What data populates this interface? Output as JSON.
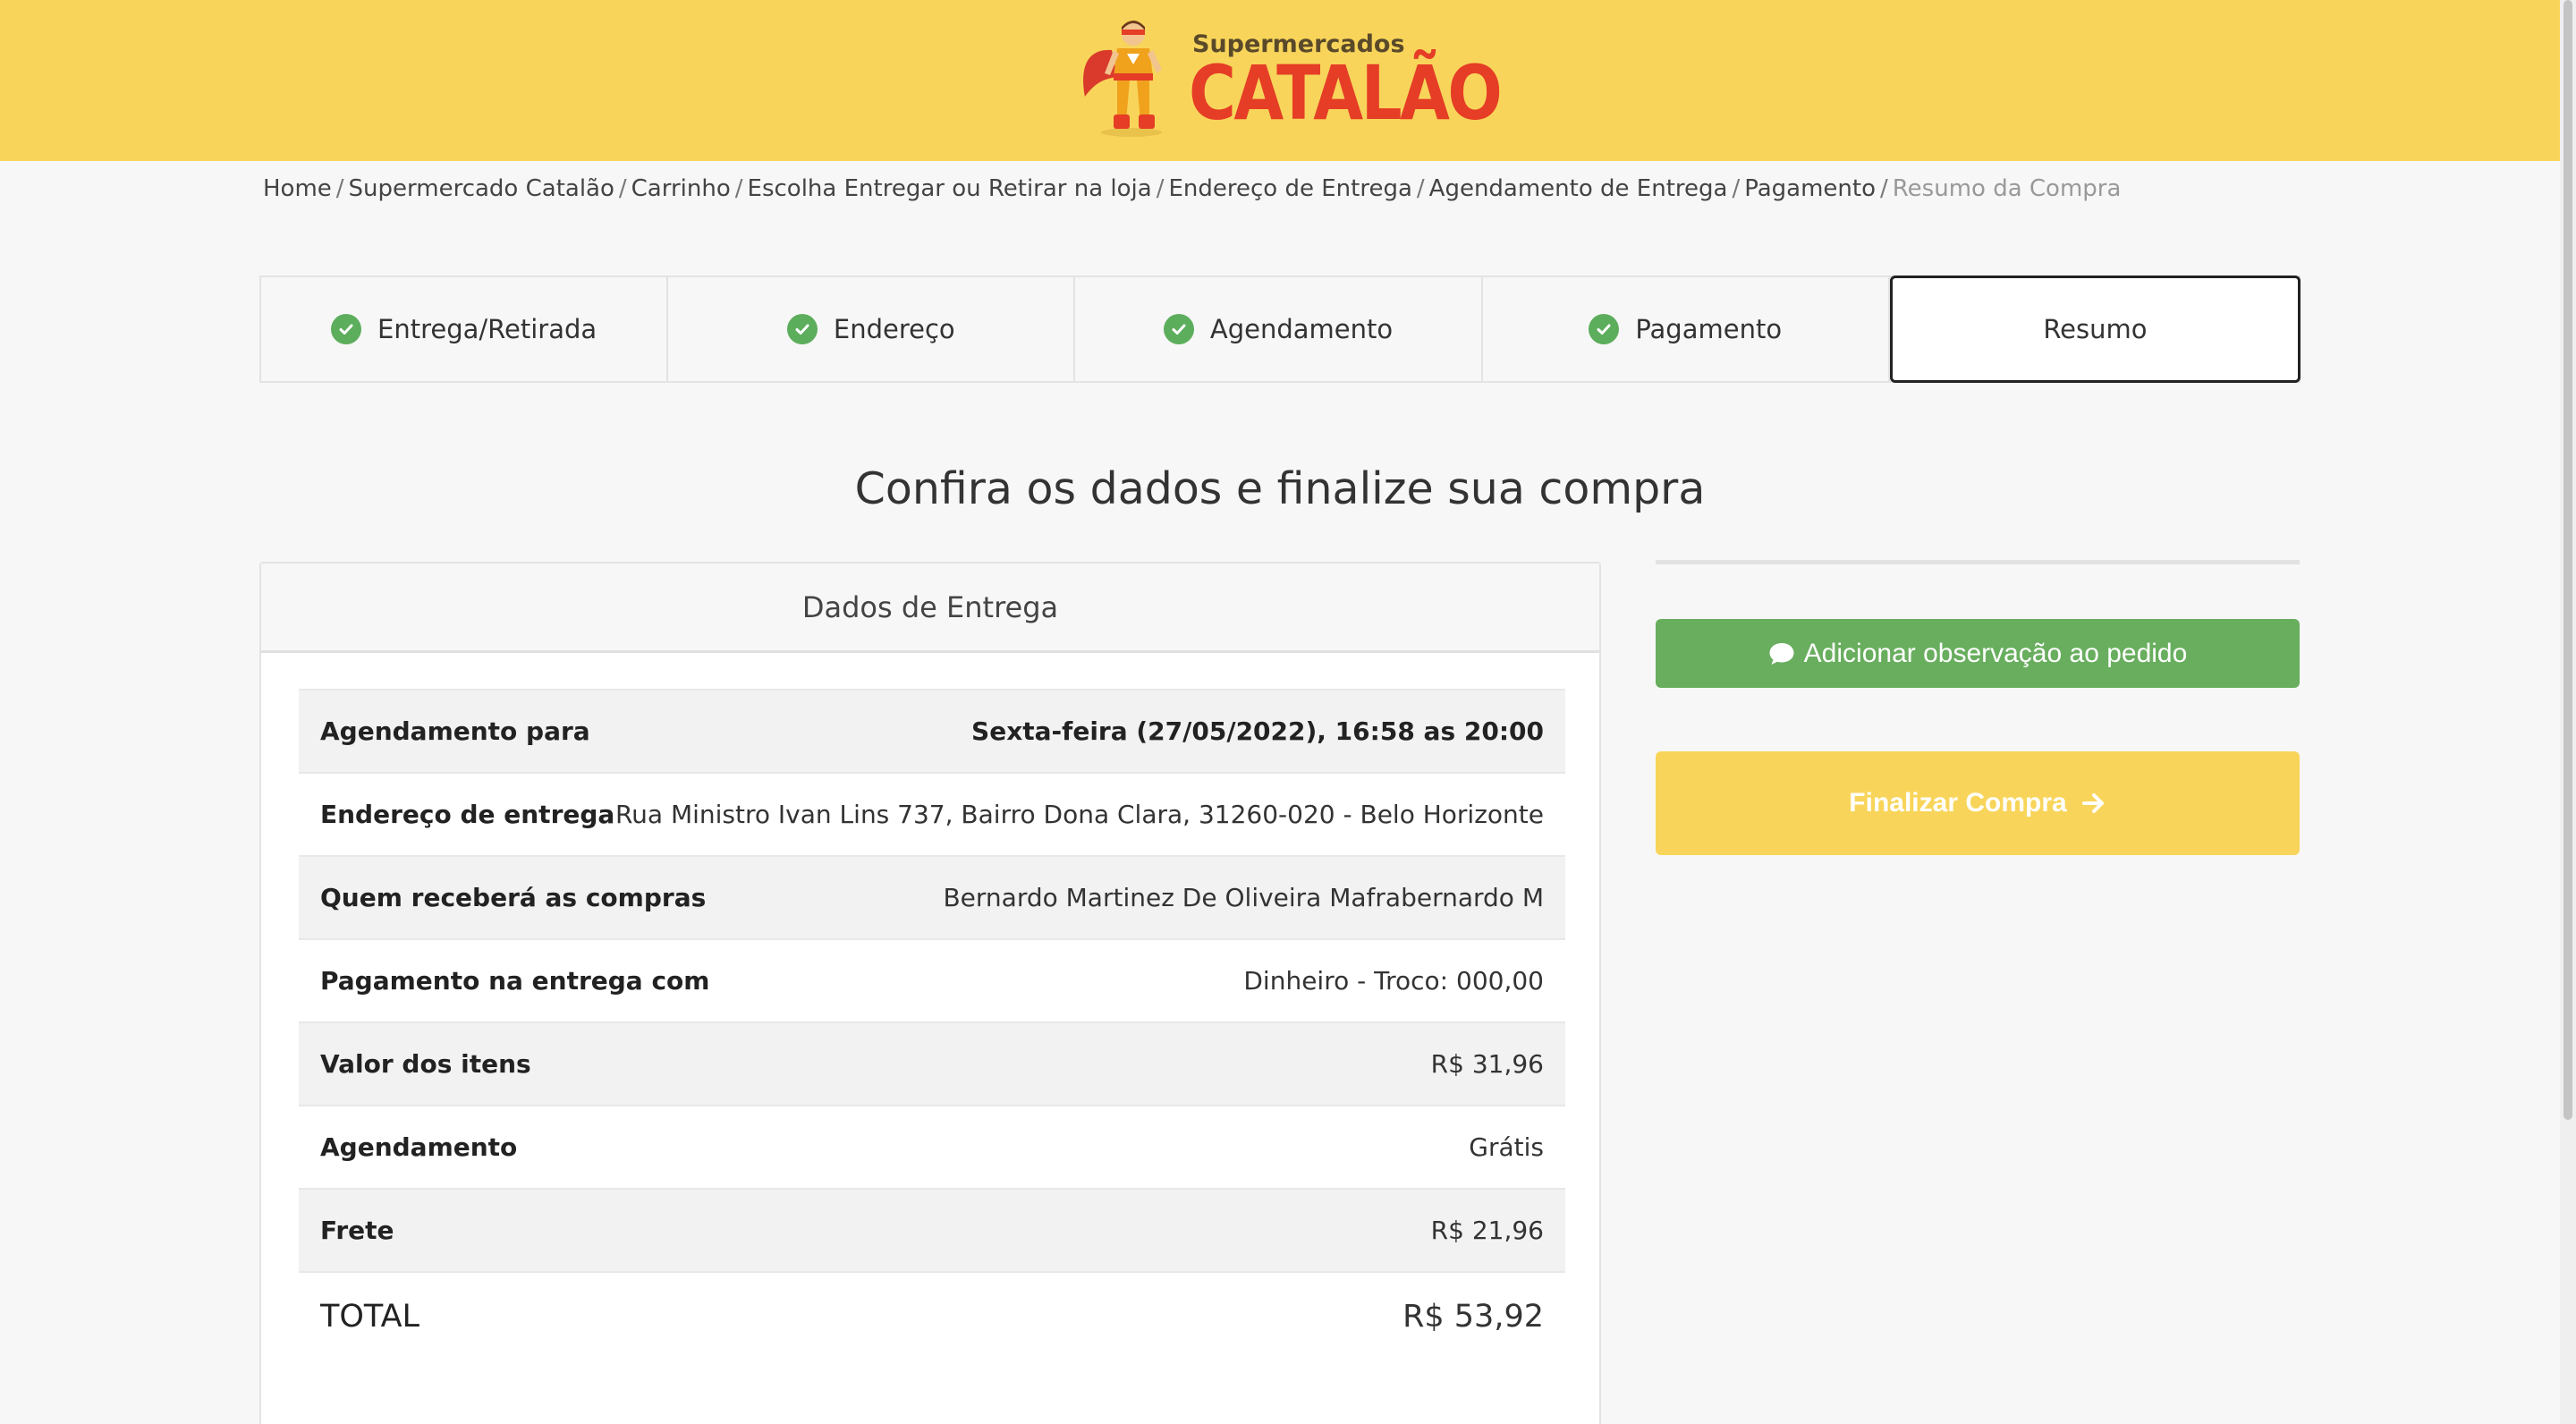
{
  "header": {
    "logo_small": "Supermercados",
    "logo_big": "CATALÃO"
  },
  "breadcrumb": [
    "Home",
    "Supermercado Catalão",
    "Carrinho",
    "Escolha Entregar ou Retirar na loja",
    "Endereço de Entrega",
    "Agendamento de Entrega",
    "Pagamento"
  ],
  "breadcrumb_current": "Resumo da Compra",
  "steps": [
    {
      "label": "Entrega/Retirada",
      "done": true
    },
    {
      "label": "Endereço",
      "done": true
    },
    {
      "label": "Agendamento",
      "done": true
    },
    {
      "label": "Pagamento",
      "done": true
    },
    {
      "label": "Resumo",
      "done": false
    }
  ],
  "headline": "Confira os dados e finalize sua compra",
  "delivery": {
    "title": "Dados de Entrega",
    "rows": [
      {
        "label": "Agendamento para",
        "value": "Sexta-feira (27/05/2022), 16:58 as 20:00"
      },
      {
        "label": "Endereço de entrega",
        "value": "Rua Ministro Ivan Lins 737, Bairro Dona Clara, 31260-020 - Belo Horizonte"
      },
      {
        "label": "Quem receberá as compras",
        "value": "Bernardo Martinez De Oliveira Mafrabernardo M"
      },
      {
        "label": "Pagamento na entrega com",
        "value": "Dinheiro - Troco: 000,00"
      },
      {
        "label": "Valor dos itens",
        "value": "R$ 31,96"
      },
      {
        "label": "Agendamento",
        "value": "Grátis"
      },
      {
        "label": "Frete",
        "value": "R$ 21,96"
      }
    ],
    "total_label": "TOTAL",
    "total_value": "R$ 53,92"
  },
  "actions": {
    "add_note": "Adicionar observação ao pedido",
    "finalize": "Finalizar Compra"
  },
  "colors": {
    "brand_yellow": "#f8d55a",
    "brand_red": "#e53d26",
    "success_green": "#68ae5e"
  }
}
